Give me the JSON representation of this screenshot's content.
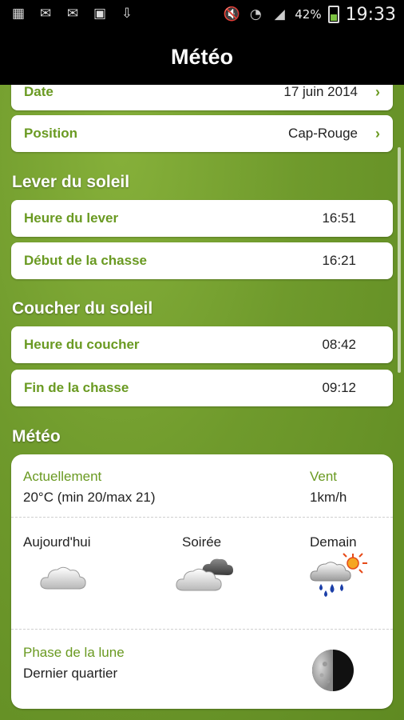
{
  "statusbar": {
    "battery_pct": "42%",
    "time": "19:33"
  },
  "header": {
    "title": "Météo"
  },
  "settings": {
    "date": {
      "label": "Date",
      "value": "17 juin 2014"
    },
    "position": {
      "label": "Position",
      "value": "Cap-Rouge"
    }
  },
  "sunrise": {
    "title": "Lever du soleil",
    "rows": [
      {
        "label": "Heure du lever",
        "value": "16:51"
      },
      {
        "label": "Début de la chasse",
        "value": "16:21"
      }
    ]
  },
  "sunset": {
    "title": "Coucher du soleil",
    "rows": [
      {
        "label": "Heure du coucher",
        "value": "08:42"
      },
      {
        "label": "Fin de la chasse",
        "value": "09:12"
      }
    ]
  },
  "weather": {
    "title": "Météo",
    "current_label": "Actuellement",
    "current_value": "20°C (min 20/max 21)",
    "wind_label": "Vent",
    "wind_value": "1km/h",
    "forecast": [
      {
        "label": "Aujourd'hui",
        "icon": "cloud-icon"
      },
      {
        "label": "Soirée",
        "icon": "cloudy-night-icon"
      },
      {
        "label": "Demain",
        "icon": "rain-sun-icon"
      }
    ],
    "moon_label": "Phase de la lune",
    "moon_value": "Dernier quartier",
    "moon_icon": "moon-last-quarter-icon"
  }
}
